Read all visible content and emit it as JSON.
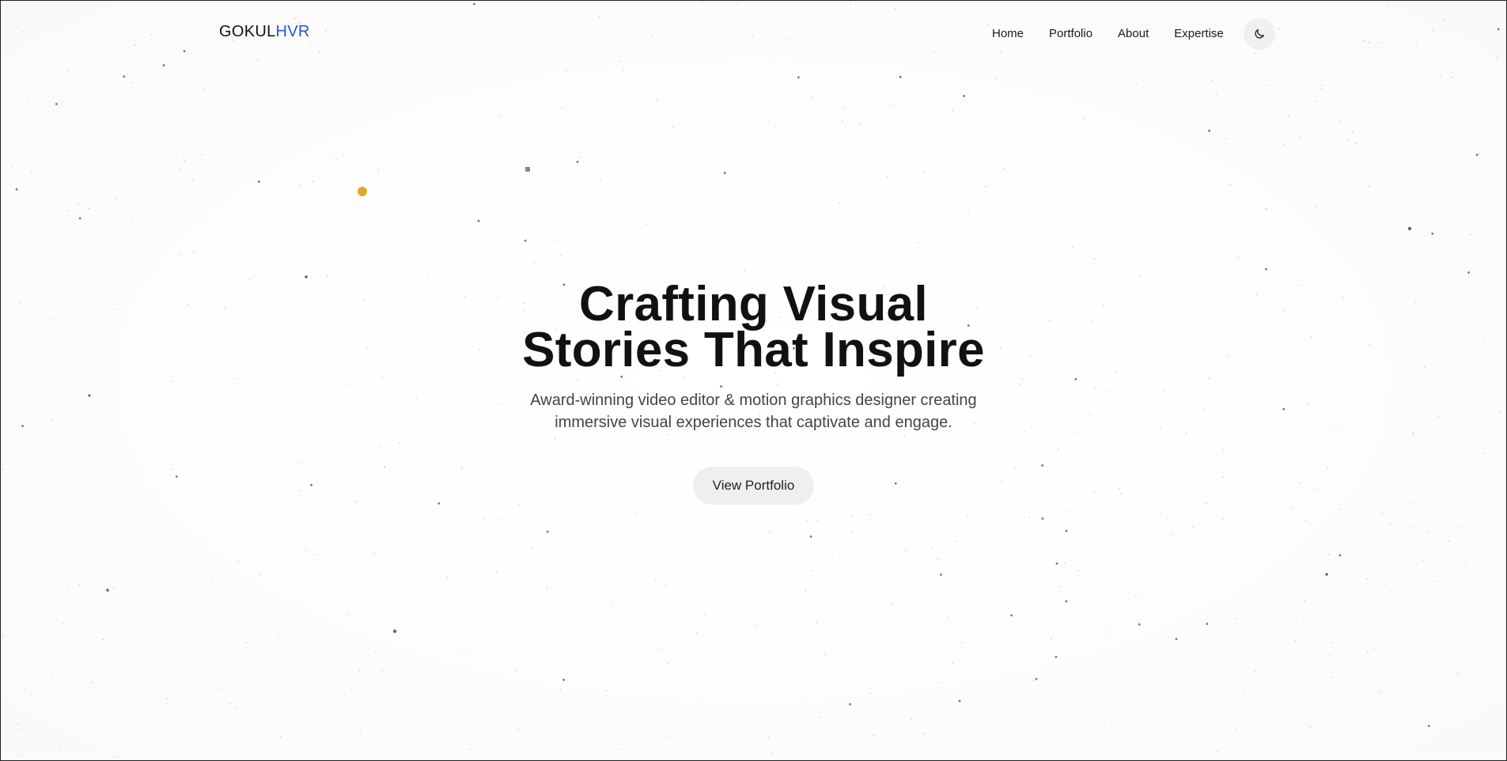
{
  "header": {
    "logo_primary": "GOKUL",
    "logo_accent": "HVR",
    "nav": [
      {
        "label": "Home"
      },
      {
        "label": "Portfolio"
      },
      {
        "label": "About"
      },
      {
        "label": "Expertise"
      }
    ],
    "theme_toggle_icon": "moon-icon"
  },
  "hero": {
    "title_line1": "Crafting Visual",
    "title_line2": "Stories That Inspire",
    "subtitle": "Award-winning video editor & motion graphics designer creating immersive visual experiences that captivate and engage.",
    "cta_label": "View Portfolio"
  },
  "colors": {
    "accent": "#2456d6",
    "highlight_dot": "#e0a91f",
    "background": "#ffffff",
    "text": "#111111"
  }
}
